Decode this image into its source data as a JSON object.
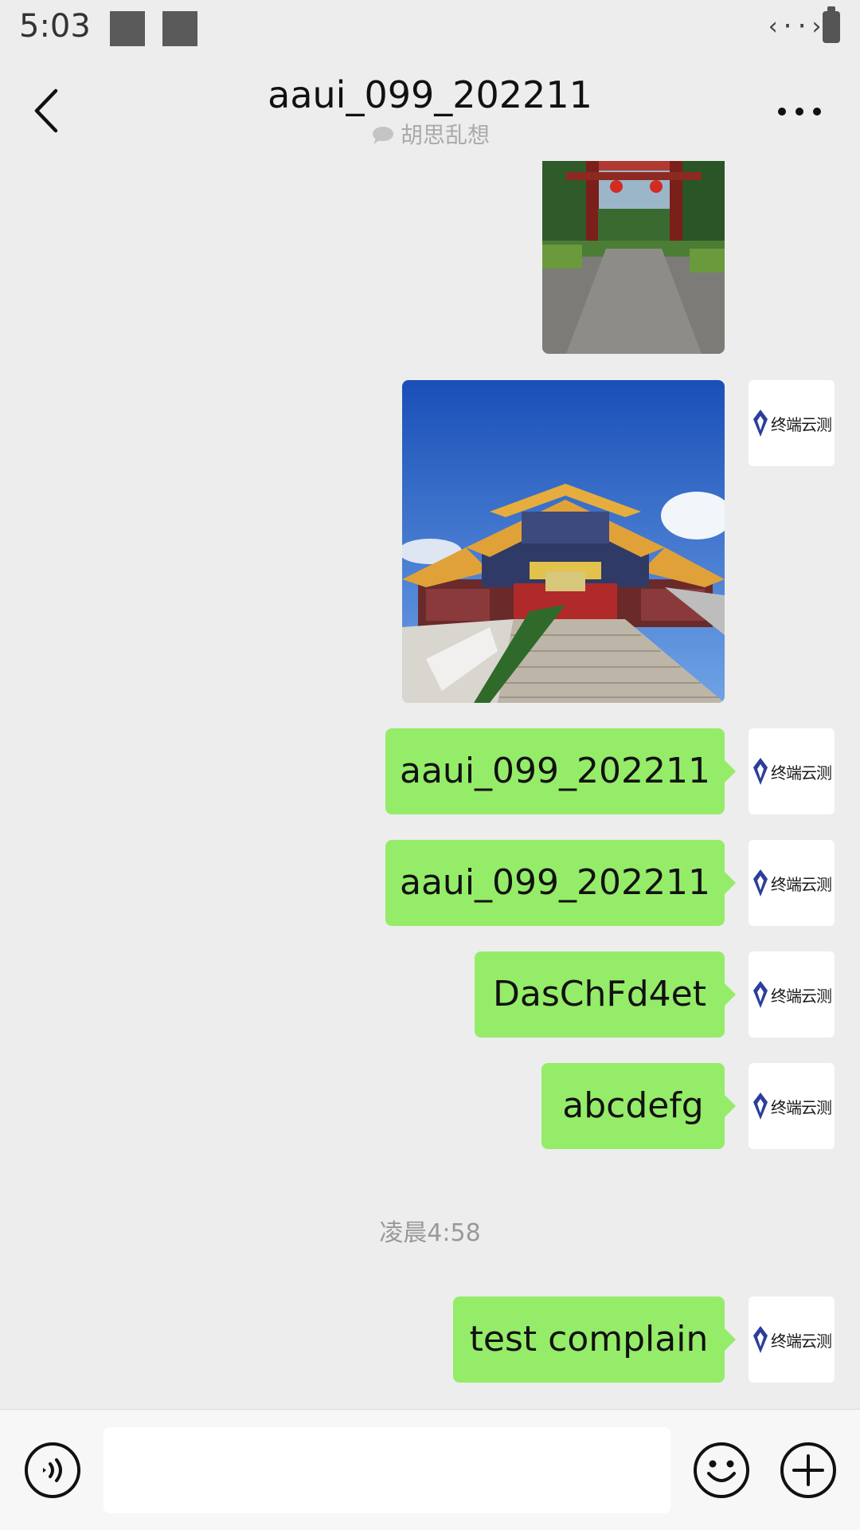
{
  "status_bar": {
    "time": "5:03",
    "network_icon": "data-transfer-icon",
    "battery_icon": "battery-icon"
  },
  "header": {
    "title": "aaui_099_202211",
    "subtitle": "胡思乱想",
    "back_icon": "chevron-left-icon",
    "more_icon": "more-horizontal-icon"
  },
  "avatar": {
    "logo_text": "终端云测"
  },
  "messages": [
    {
      "type": "image",
      "content": "photo of red stone archway gate with lanterns and paved path"
    },
    {
      "type": "image",
      "content": "photo of Chinese temple with yellow roofs and stone stairs under blue sky"
    },
    {
      "type": "text",
      "text": "aaui_099_202211"
    },
    {
      "type": "text",
      "text": "aaui_099_202211"
    },
    {
      "type": "text",
      "text": "DasChFd4et"
    },
    {
      "type": "text",
      "text": "abcdefg"
    },
    {
      "type": "time",
      "text": "凌晨4:58"
    },
    {
      "type": "text",
      "text": "test complain"
    }
  ],
  "input_bar": {
    "voice_icon": "voice-input-icon",
    "input_value": "",
    "emoji_icon": "emoji-icon",
    "plus_icon": "plus-icon"
  },
  "colors": {
    "background": "#ededed",
    "bubble": "#95ec69",
    "input_bar": "#f7f7f7"
  }
}
